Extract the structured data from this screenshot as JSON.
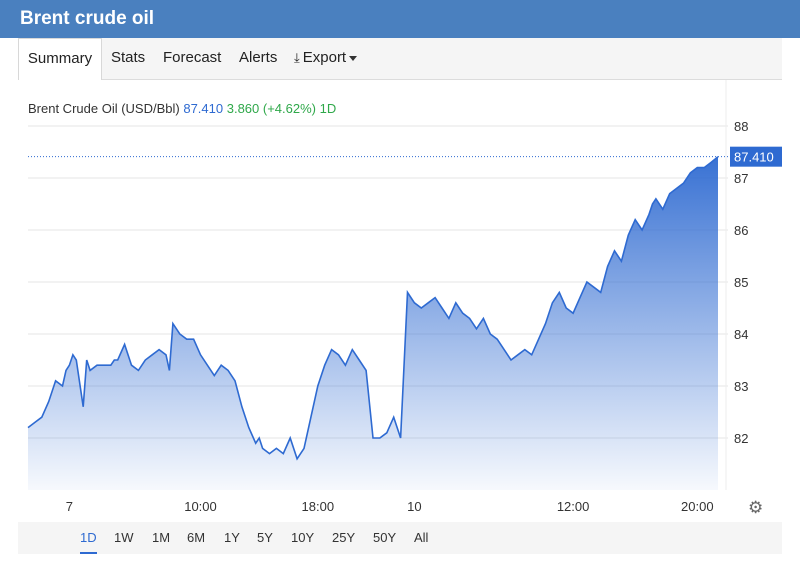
{
  "window": {
    "title": "Brent crude oil"
  },
  "tabs": [
    {
      "label": "Summary",
      "active": true
    },
    {
      "label": "Stats"
    },
    {
      "label": "Forecast"
    },
    {
      "label": "Alerts"
    },
    {
      "label": "Export"
    }
  ],
  "info": {
    "name": "Brent Crude Oil (USD/Bbl)",
    "price": "87.410",
    "change": "3.860 (+4.62%)",
    "period": "1D"
  },
  "ranges": [
    {
      "label": "1D",
      "active": true
    },
    {
      "label": "1W"
    },
    {
      "label": "1M"
    },
    {
      "label": "6M"
    },
    {
      "label": "1Y"
    },
    {
      "label": "5Y"
    },
    {
      "label": "10Y"
    },
    {
      "label": "25Y"
    },
    {
      "label": "50Y"
    },
    {
      "label": "All"
    }
  ],
  "colors": {
    "header": "#4a80bf",
    "line": "#2e6ad1",
    "up": "#2fa84a"
  },
  "chart_data": {
    "type": "area",
    "ylim": [
      81,
      88.5
    ],
    "y_ticks": [
      82,
      83,
      84,
      85,
      86,
      87,
      88
    ],
    "x_ticks": [
      {
        "label": "7",
        "t": 0.06
      },
      {
        "label": "10:00",
        "t": 0.25
      },
      {
        "label": "18:00",
        "t": 0.42
      },
      {
        "label": "10",
        "t": 0.56
      },
      {
        "label": "12:00",
        "t": 0.79
      },
      {
        "label": "20:00",
        "t": 0.97
      }
    ],
    "last_value_label": "87.410",
    "series": [
      {
        "x": [
          0,
          0.01,
          0.02,
          0.03,
          0.04,
          0.05,
          0.055,
          0.06,
          0.065,
          0.07,
          0.08,
          0.085,
          0.09,
          0.1,
          0.11,
          0.12,
          0.125,
          0.13,
          0.14,
          0.15,
          0.16,
          0.17,
          0.18,
          0.19,
          0.2,
          0.205,
          0.21,
          0.22,
          0.23,
          0.24,
          0.25,
          0.26,
          0.27,
          0.28,
          0.29,
          0.3,
          0.31,
          0.32,
          0.33,
          0.335,
          0.34,
          0.35,
          0.36,
          0.37,
          0.38,
          0.39,
          0.4,
          0.41,
          0.42,
          0.43,
          0.44,
          0.45,
          0.46,
          0.47,
          0.48,
          0.49,
          0.5,
          0.51,
          0.52,
          0.53,
          0.54,
          0.55,
          0.56,
          0.57,
          0.58,
          0.59,
          0.6,
          0.61,
          0.62,
          0.63,
          0.64,
          0.65,
          0.66,
          0.67,
          0.68,
          0.69,
          0.7,
          0.71,
          0.72,
          0.73,
          0.74,
          0.75,
          0.76,
          0.77,
          0.78,
          0.79,
          0.8,
          0.81,
          0.82,
          0.83,
          0.84,
          0.85,
          0.86,
          0.87,
          0.88,
          0.89,
          0.9,
          0.905,
          0.91,
          0.92,
          0.93,
          0.94,
          0.95,
          0.96,
          0.97,
          0.98,
          0.99,
          1.0
        ],
        "values": [
          82.2,
          82.3,
          82.4,
          82.7,
          83.1,
          83.0,
          83.3,
          83.4,
          83.6,
          83.5,
          82.6,
          83.5,
          83.3,
          83.4,
          83.4,
          83.4,
          83.5,
          83.5,
          83.8,
          83.4,
          83.3,
          83.5,
          83.6,
          83.7,
          83.6,
          83.3,
          84.2,
          84.0,
          83.9,
          83.9,
          83.6,
          83.4,
          83.2,
          83.4,
          83.3,
          83.1,
          82.6,
          82.2,
          81.9,
          82.0,
          81.8,
          81.7,
          81.8,
          81.7,
          82.0,
          81.6,
          81.8,
          82.4,
          83.0,
          83.4,
          83.7,
          83.6,
          83.4,
          83.7,
          83.5,
          83.3,
          82.0,
          82.0,
          82.1,
          82.4,
          82.0,
          84.8,
          84.6,
          84.5,
          84.6,
          84.7,
          84.5,
          84.3,
          84.6,
          84.4,
          84.3,
          84.1,
          84.3,
          84.0,
          83.9,
          83.7,
          83.5,
          83.6,
          83.7,
          83.6,
          83.9,
          84.2,
          84.6,
          84.8,
          84.5,
          84.4,
          84.7,
          85.0,
          84.9,
          84.8,
          85.3,
          85.6,
          85.4,
          85.9,
          86.2,
          86.0,
          86.3,
          86.5,
          86.6,
          86.4,
          86.7,
          86.8,
          86.9,
          87.1,
          87.2,
          87.2,
          87.3,
          87.41
        ]
      }
    ]
  }
}
